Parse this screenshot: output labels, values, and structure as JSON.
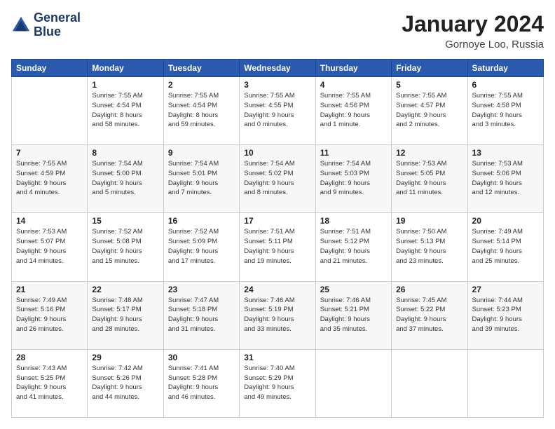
{
  "logo": {
    "line1": "General",
    "line2": "Blue"
  },
  "title": "January 2024",
  "location": "Gornoye Loo, Russia",
  "days_header": [
    "Sunday",
    "Monday",
    "Tuesday",
    "Wednesday",
    "Thursday",
    "Friday",
    "Saturday"
  ],
  "weeks": [
    [
      {
        "num": "",
        "sunrise": "",
        "sunset": "",
        "daylight": ""
      },
      {
        "num": "1",
        "sunrise": "Sunrise: 7:55 AM",
        "sunset": "Sunset: 4:54 PM",
        "daylight": "Daylight: 8 hours and 58 minutes."
      },
      {
        "num": "2",
        "sunrise": "Sunrise: 7:55 AM",
        "sunset": "Sunset: 4:54 PM",
        "daylight": "Daylight: 8 hours and 59 minutes."
      },
      {
        "num": "3",
        "sunrise": "Sunrise: 7:55 AM",
        "sunset": "Sunset: 4:55 PM",
        "daylight": "Daylight: 9 hours and 0 minutes."
      },
      {
        "num": "4",
        "sunrise": "Sunrise: 7:55 AM",
        "sunset": "Sunset: 4:56 PM",
        "daylight": "Daylight: 9 hours and 1 minute."
      },
      {
        "num": "5",
        "sunrise": "Sunrise: 7:55 AM",
        "sunset": "Sunset: 4:57 PM",
        "daylight": "Daylight: 9 hours and 2 minutes."
      },
      {
        "num": "6",
        "sunrise": "Sunrise: 7:55 AM",
        "sunset": "Sunset: 4:58 PM",
        "daylight": "Daylight: 9 hours and 3 minutes."
      }
    ],
    [
      {
        "num": "7",
        "sunrise": "Sunrise: 7:55 AM",
        "sunset": "Sunset: 4:59 PM",
        "daylight": "Daylight: 9 hours and 4 minutes."
      },
      {
        "num": "8",
        "sunrise": "Sunrise: 7:54 AM",
        "sunset": "Sunset: 5:00 PM",
        "daylight": "Daylight: 9 hours and 5 minutes."
      },
      {
        "num": "9",
        "sunrise": "Sunrise: 7:54 AM",
        "sunset": "Sunset: 5:01 PM",
        "daylight": "Daylight: 9 hours and 7 minutes."
      },
      {
        "num": "10",
        "sunrise": "Sunrise: 7:54 AM",
        "sunset": "Sunset: 5:02 PM",
        "daylight": "Daylight: 9 hours and 8 minutes."
      },
      {
        "num": "11",
        "sunrise": "Sunrise: 7:54 AM",
        "sunset": "Sunset: 5:03 PM",
        "daylight": "Daylight: 9 hours and 9 minutes."
      },
      {
        "num": "12",
        "sunrise": "Sunrise: 7:53 AM",
        "sunset": "Sunset: 5:05 PM",
        "daylight": "Daylight: 9 hours and 11 minutes."
      },
      {
        "num": "13",
        "sunrise": "Sunrise: 7:53 AM",
        "sunset": "Sunset: 5:06 PM",
        "daylight": "Daylight: 9 hours and 12 minutes."
      }
    ],
    [
      {
        "num": "14",
        "sunrise": "Sunrise: 7:53 AM",
        "sunset": "Sunset: 5:07 PM",
        "daylight": "Daylight: 9 hours and 14 minutes."
      },
      {
        "num": "15",
        "sunrise": "Sunrise: 7:52 AM",
        "sunset": "Sunset: 5:08 PM",
        "daylight": "Daylight: 9 hours and 15 minutes."
      },
      {
        "num": "16",
        "sunrise": "Sunrise: 7:52 AM",
        "sunset": "Sunset: 5:09 PM",
        "daylight": "Daylight: 9 hours and 17 minutes."
      },
      {
        "num": "17",
        "sunrise": "Sunrise: 7:51 AM",
        "sunset": "Sunset: 5:11 PM",
        "daylight": "Daylight: 9 hours and 19 minutes."
      },
      {
        "num": "18",
        "sunrise": "Sunrise: 7:51 AM",
        "sunset": "Sunset: 5:12 PM",
        "daylight": "Daylight: 9 hours and 21 minutes."
      },
      {
        "num": "19",
        "sunrise": "Sunrise: 7:50 AM",
        "sunset": "Sunset: 5:13 PM",
        "daylight": "Daylight: 9 hours and 23 minutes."
      },
      {
        "num": "20",
        "sunrise": "Sunrise: 7:49 AM",
        "sunset": "Sunset: 5:14 PM",
        "daylight": "Daylight: 9 hours and 25 minutes."
      }
    ],
    [
      {
        "num": "21",
        "sunrise": "Sunrise: 7:49 AM",
        "sunset": "Sunset: 5:16 PM",
        "daylight": "Daylight: 9 hours and 26 minutes."
      },
      {
        "num": "22",
        "sunrise": "Sunrise: 7:48 AM",
        "sunset": "Sunset: 5:17 PM",
        "daylight": "Daylight: 9 hours and 28 minutes."
      },
      {
        "num": "23",
        "sunrise": "Sunrise: 7:47 AM",
        "sunset": "Sunset: 5:18 PM",
        "daylight": "Daylight: 9 hours and 31 minutes."
      },
      {
        "num": "24",
        "sunrise": "Sunrise: 7:46 AM",
        "sunset": "Sunset: 5:19 PM",
        "daylight": "Daylight: 9 hours and 33 minutes."
      },
      {
        "num": "25",
        "sunrise": "Sunrise: 7:46 AM",
        "sunset": "Sunset: 5:21 PM",
        "daylight": "Daylight: 9 hours and 35 minutes."
      },
      {
        "num": "26",
        "sunrise": "Sunrise: 7:45 AM",
        "sunset": "Sunset: 5:22 PM",
        "daylight": "Daylight: 9 hours and 37 minutes."
      },
      {
        "num": "27",
        "sunrise": "Sunrise: 7:44 AM",
        "sunset": "Sunset: 5:23 PM",
        "daylight": "Daylight: 9 hours and 39 minutes."
      }
    ],
    [
      {
        "num": "28",
        "sunrise": "Sunrise: 7:43 AM",
        "sunset": "Sunset: 5:25 PM",
        "daylight": "Daylight: 9 hours and 41 minutes."
      },
      {
        "num": "29",
        "sunrise": "Sunrise: 7:42 AM",
        "sunset": "Sunset: 5:26 PM",
        "daylight": "Daylight: 9 hours and 44 minutes."
      },
      {
        "num": "30",
        "sunrise": "Sunrise: 7:41 AM",
        "sunset": "Sunset: 5:28 PM",
        "daylight": "Daylight: 9 hours and 46 minutes."
      },
      {
        "num": "31",
        "sunrise": "Sunrise: 7:40 AM",
        "sunset": "Sunset: 5:29 PM",
        "daylight": "Daylight: 9 hours and 49 minutes."
      },
      {
        "num": "",
        "sunrise": "",
        "sunset": "",
        "daylight": ""
      },
      {
        "num": "",
        "sunrise": "",
        "sunset": "",
        "daylight": ""
      },
      {
        "num": "",
        "sunrise": "",
        "sunset": "",
        "daylight": ""
      }
    ]
  ]
}
